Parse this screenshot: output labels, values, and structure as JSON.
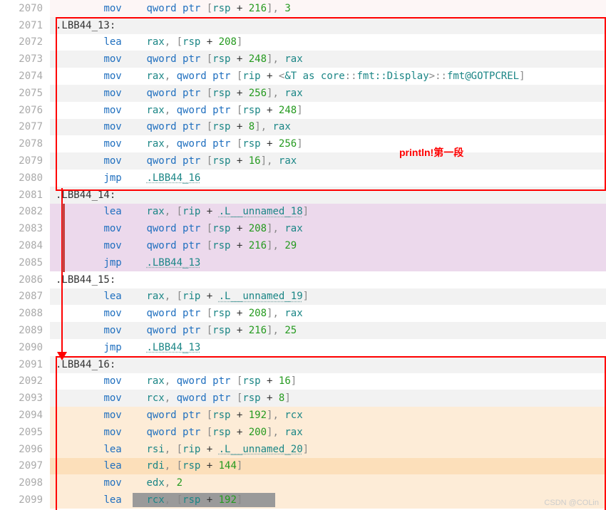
{
  "annotation": "println!第一段",
  "watermark": "CSDN @COLin",
  "lines": [
    {
      "n": "2070",
      "bg": "bg-pink-light",
      "seg": [
        [
          "        ",
          "t-dark"
        ],
        [
          "mov",
          "t-blue op"
        ],
        [
          "qword ptr",
          "t-blue"
        ],
        [
          " [",
          "t-gray"
        ],
        [
          "rsp",
          "t-teal"
        ],
        [
          " + ",
          "t-dark"
        ],
        [
          "216",
          "t-green"
        ],
        [
          "], ",
          "t-gray"
        ],
        [
          "3",
          "t-green"
        ]
      ]
    },
    {
      "n": "2071",
      "bg": "bg-gray-light",
      "seg": [
        [
          ".LBB44_13:",
          "t-dark"
        ]
      ]
    },
    {
      "n": "2072",
      "bg": "bg-white",
      "seg": [
        [
          "        ",
          "t-dark"
        ],
        [
          "lea",
          "t-blue op"
        ],
        [
          "rax",
          "t-teal"
        ],
        [
          ", [",
          "t-gray"
        ],
        [
          "rsp",
          "t-teal"
        ],
        [
          " + ",
          "t-dark"
        ],
        [
          "208",
          "t-green"
        ],
        [
          "]",
          "t-gray"
        ]
      ]
    },
    {
      "n": "2073",
      "bg": "bg-gray-light",
      "seg": [
        [
          "        ",
          "t-dark"
        ],
        [
          "mov",
          "t-blue op"
        ],
        [
          "qword ptr",
          "t-blue"
        ],
        [
          " [",
          "t-gray"
        ],
        [
          "rsp",
          "t-teal"
        ],
        [
          " + ",
          "t-dark"
        ],
        [
          "248",
          "t-green"
        ],
        [
          "], ",
          "t-gray"
        ],
        [
          "rax",
          "t-teal"
        ]
      ]
    },
    {
      "n": "2074",
      "bg": "bg-white",
      "seg": [
        [
          "        ",
          "t-dark"
        ],
        [
          "mov",
          "t-blue op"
        ],
        [
          "rax",
          "t-teal"
        ],
        [
          ", ",
          "t-gray"
        ],
        [
          "qword ptr",
          "t-blue"
        ],
        [
          " [",
          "t-gray"
        ],
        [
          "rip",
          "t-teal"
        ],
        [
          " + ",
          "t-dark"
        ],
        [
          "<",
          "t-gray"
        ],
        [
          "&T as core",
          "t-teal"
        ],
        [
          "::",
          "t-gray"
        ],
        [
          "fmt::Display",
          "t-teal"
        ],
        [
          ">::",
          "t-gray"
        ],
        [
          "fmt@GOTPCREL",
          "t-teal"
        ],
        [
          "]",
          "t-gray"
        ]
      ]
    },
    {
      "n": "2075",
      "bg": "bg-gray-light",
      "seg": [
        [
          "        ",
          "t-dark"
        ],
        [
          "mov",
          "t-blue op"
        ],
        [
          "qword ptr",
          "t-blue"
        ],
        [
          " [",
          "t-gray"
        ],
        [
          "rsp",
          "t-teal"
        ],
        [
          " + ",
          "t-dark"
        ],
        [
          "256",
          "t-green"
        ],
        [
          "], ",
          "t-gray"
        ],
        [
          "rax",
          "t-teal"
        ]
      ]
    },
    {
      "n": "2076",
      "bg": "bg-white",
      "seg": [
        [
          "        ",
          "t-dark"
        ],
        [
          "mov",
          "t-blue op"
        ],
        [
          "rax",
          "t-teal"
        ],
        [
          ", ",
          "t-gray"
        ],
        [
          "qword ptr",
          "t-blue"
        ],
        [
          " [",
          "t-gray"
        ],
        [
          "rsp",
          "t-teal"
        ],
        [
          " + ",
          "t-dark"
        ],
        [
          "248",
          "t-green"
        ],
        [
          "]",
          "t-gray"
        ]
      ]
    },
    {
      "n": "2077",
      "bg": "bg-gray-light",
      "seg": [
        [
          "        ",
          "t-dark"
        ],
        [
          "mov",
          "t-blue op"
        ],
        [
          "qword ptr",
          "t-blue"
        ],
        [
          " [",
          "t-gray"
        ],
        [
          "rsp",
          "t-teal"
        ],
        [
          " + ",
          "t-dark"
        ],
        [
          "8",
          "t-green"
        ],
        [
          "], ",
          "t-gray"
        ],
        [
          "rax",
          "t-teal"
        ]
      ]
    },
    {
      "n": "2078",
      "bg": "bg-white",
      "seg": [
        [
          "        ",
          "t-dark"
        ],
        [
          "mov",
          "t-blue op"
        ],
        [
          "rax",
          "t-teal"
        ],
        [
          ", ",
          "t-gray"
        ],
        [
          "qword ptr",
          "t-blue"
        ],
        [
          " [",
          "t-gray"
        ],
        [
          "rsp",
          "t-teal"
        ],
        [
          " + ",
          "t-dark"
        ],
        [
          "256",
          "t-green"
        ],
        [
          "]",
          "t-gray"
        ]
      ]
    },
    {
      "n": "2079",
      "bg": "bg-gray-light",
      "seg": [
        [
          "        ",
          "t-dark"
        ],
        [
          "mov",
          "t-blue op"
        ],
        [
          "qword ptr",
          "t-blue"
        ],
        [
          " [",
          "t-gray"
        ],
        [
          "rsp",
          "t-teal"
        ],
        [
          " + ",
          "t-dark"
        ],
        [
          "16",
          "t-green"
        ],
        [
          "], ",
          "t-gray"
        ],
        [
          "rax",
          "t-teal"
        ]
      ]
    },
    {
      "n": "2080",
      "bg": "bg-white",
      "seg": [
        [
          "        ",
          "t-dark"
        ],
        [
          "jmp",
          "t-blue op"
        ],
        [
          ".LBB44_16",
          "t-teal u"
        ]
      ]
    },
    {
      "n": "2081",
      "bg": "bg-gray-light",
      "seg": [
        [
          ".LBB44_14:",
          "t-dark"
        ]
      ]
    },
    {
      "n": "2082",
      "bg": "bg-purple",
      "seg": [
        [
          "        ",
          "t-dark"
        ],
        [
          "lea",
          "t-blue op"
        ],
        [
          "rax",
          "t-teal"
        ],
        [
          ", [",
          "t-gray"
        ],
        [
          "rip",
          "t-teal"
        ],
        [
          " + ",
          "t-dark"
        ],
        [
          ".L__unnamed_18",
          "t-teal u"
        ],
        [
          "]",
          "t-gray"
        ]
      ]
    },
    {
      "n": "2083",
      "bg": "bg-purple",
      "seg": [
        [
          "        ",
          "t-dark"
        ],
        [
          "mov",
          "t-blue op"
        ],
        [
          "qword ptr",
          "t-blue"
        ],
        [
          " [",
          "t-gray"
        ],
        [
          "rsp",
          "t-teal"
        ],
        [
          " + ",
          "t-dark"
        ],
        [
          "208",
          "t-green"
        ],
        [
          "], ",
          "t-gray"
        ],
        [
          "rax",
          "t-teal"
        ]
      ]
    },
    {
      "n": "2084",
      "bg": "bg-purple",
      "seg": [
        [
          "        ",
          "t-dark"
        ],
        [
          "mov",
          "t-blue op"
        ],
        [
          "qword ptr",
          "t-blue"
        ],
        [
          " [",
          "t-gray"
        ],
        [
          "rsp",
          "t-teal"
        ],
        [
          " + ",
          "t-dark"
        ],
        [
          "216",
          "t-green"
        ],
        [
          "], ",
          "t-gray"
        ],
        [
          "29",
          "t-green"
        ]
      ]
    },
    {
      "n": "2085",
      "bg": "bg-purple",
      "seg": [
        [
          "        ",
          "t-dark"
        ],
        [
          "jmp",
          "t-blue op"
        ],
        [
          ".LBB44_13",
          "t-teal u"
        ]
      ]
    },
    {
      "n": "2086",
      "bg": "bg-white",
      "seg": [
        [
          ".LBB44_15:",
          "t-dark"
        ]
      ]
    },
    {
      "n": "2087",
      "bg": "bg-gray-light",
      "seg": [
        [
          "        ",
          "t-dark"
        ],
        [
          "lea",
          "t-blue op"
        ],
        [
          "rax",
          "t-teal"
        ],
        [
          ", [",
          "t-gray"
        ],
        [
          "rip",
          "t-teal"
        ],
        [
          " + ",
          "t-dark"
        ],
        [
          ".L__unnamed_19",
          "t-teal u"
        ],
        [
          "]",
          "t-gray"
        ]
      ]
    },
    {
      "n": "2088",
      "bg": "bg-white",
      "seg": [
        [
          "        ",
          "t-dark"
        ],
        [
          "mov",
          "t-blue op"
        ],
        [
          "qword ptr",
          "t-blue"
        ],
        [
          " [",
          "t-gray"
        ],
        [
          "rsp",
          "t-teal"
        ],
        [
          " + ",
          "t-dark"
        ],
        [
          "208",
          "t-green"
        ],
        [
          "], ",
          "t-gray"
        ],
        [
          "rax",
          "t-teal"
        ]
      ]
    },
    {
      "n": "2089",
      "bg": "bg-gray-light",
      "seg": [
        [
          "        ",
          "t-dark"
        ],
        [
          "mov",
          "t-blue op"
        ],
        [
          "qword ptr",
          "t-blue"
        ],
        [
          " [",
          "t-gray"
        ],
        [
          "rsp",
          "t-teal"
        ],
        [
          " + ",
          "t-dark"
        ],
        [
          "216",
          "t-green"
        ],
        [
          "], ",
          "t-gray"
        ],
        [
          "25",
          "t-green"
        ]
      ]
    },
    {
      "n": "2090",
      "bg": "bg-white",
      "seg": [
        [
          "        ",
          "t-dark"
        ],
        [
          "jmp",
          "t-blue op"
        ],
        [
          ".LBB44_13",
          "t-teal u"
        ]
      ]
    },
    {
      "n": "2091",
      "bg": "bg-gray-light",
      "seg": [
        [
          ".LBB44_16:",
          "t-dark"
        ]
      ]
    },
    {
      "n": "2092",
      "bg": "bg-white",
      "seg": [
        [
          "        ",
          "t-dark"
        ],
        [
          "mov",
          "t-blue op"
        ],
        [
          "rax",
          "t-teal"
        ],
        [
          ", ",
          "t-gray"
        ],
        [
          "qword ptr",
          "t-blue"
        ],
        [
          " [",
          "t-gray"
        ],
        [
          "rsp",
          "t-teal"
        ],
        [
          " + ",
          "t-dark"
        ],
        [
          "16",
          "t-green"
        ],
        [
          "]",
          "t-gray"
        ]
      ]
    },
    {
      "n": "2093",
      "bg": "bg-gray-light",
      "seg": [
        [
          "        ",
          "t-dark"
        ],
        [
          "mov",
          "t-blue op"
        ],
        [
          "rcx",
          "t-teal"
        ],
        [
          ", ",
          "t-gray"
        ],
        [
          "qword ptr",
          "t-blue"
        ],
        [
          " [",
          "t-gray"
        ],
        [
          "rsp",
          "t-teal"
        ],
        [
          " + ",
          "t-dark"
        ],
        [
          "8",
          "t-green"
        ],
        [
          "]",
          "t-gray"
        ]
      ]
    },
    {
      "n": "2094",
      "bg": "bg-orange-l",
      "seg": [
        [
          "        ",
          "t-dark"
        ],
        [
          "mov",
          "t-blue op"
        ],
        [
          "qword ptr",
          "t-blue"
        ],
        [
          " [",
          "t-gray"
        ],
        [
          "rsp",
          "t-teal"
        ],
        [
          " + ",
          "t-dark"
        ],
        [
          "192",
          "t-green"
        ],
        [
          "], ",
          "t-gray"
        ],
        [
          "rcx",
          "t-teal"
        ]
      ]
    },
    {
      "n": "2095",
      "bg": "bg-orange-l",
      "seg": [
        [
          "        ",
          "t-dark"
        ],
        [
          "mov",
          "t-blue op"
        ],
        [
          "qword ptr",
          "t-blue"
        ],
        [
          " [",
          "t-gray"
        ],
        [
          "rsp",
          "t-teal"
        ],
        [
          " + ",
          "t-dark"
        ],
        [
          "200",
          "t-green"
        ],
        [
          "], ",
          "t-gray"
        ],
        [
          "rax",
          "t-teal"
        ]
      ]
    },
    {
      "n": "2096",
      "bg": "bg-orange-l",
      "seg": [
        [
          "        ",
          "t-dark"
        ],
        [
          "lea",
          "t-blue op"
        ],
        [
          "rsi",
          "t-teal"
        ],
        [
          ", [",
          "t-gray"
        ],
        [
          "rip",
          "t-teal"
        ],
        [
          " + ",
          "t-dark"
        ],
        [
          ".L__unnamed_20",
          "t-teal u"
        ],
        [
          "]",
          "t-gray"
        ]
      ]
    },
    {
      "n": "2097",
      "bg": "bg-orange-d",
      "seg": [
        [
          "        ",
          "t-dark"
        ],
        [
          "lea",
          "t-blue op"
        ],
        [
          "rdi",
          "t-teal"
        ],
        [
          ", [",
          "t-gray"
        ],
        [
          "rsp",
          "t-teal"
        ],
        [
          " + ",
          "t-dark"
        ],
        [
          "144",
          "t-green"
        ],
        [
          "]",
          "t-gray"
        ]
      ]
    },
    {
      "n": "2098",
      "bg": "bg-orange-l",
      "seg": [
        [
          "        ",
          "t-dark"
        ],
        [
          "mov",
          "t-blue op"
        ],
        [
          "edx",
          "t-teal"
        ],
        [
          ", ",
          "t-gray"
        ],
        [
          "2",
          "t-green"
        ]
      ]
    },
    {
      "n": "2099",
      "bg": "bg-orange-l",
      "seg": [
        [
          "        ",
          "t-dark"
        ],
        [
          "lea",
          "t-blue op"
        ],
        [
          "rcx",
          "t-teal"
        ],
        [
          ", [",
          "t-gray"
        ],
        [
          "rsp",
          "t-teal"
        ],
        [
          " + ",
          "t-dark"
        ],
        [
          "192",
          "t-green"
        ],
        [
          "]",
          "t-gray"
        ]
      ],
      "graybar": true
    }
  ]
}
